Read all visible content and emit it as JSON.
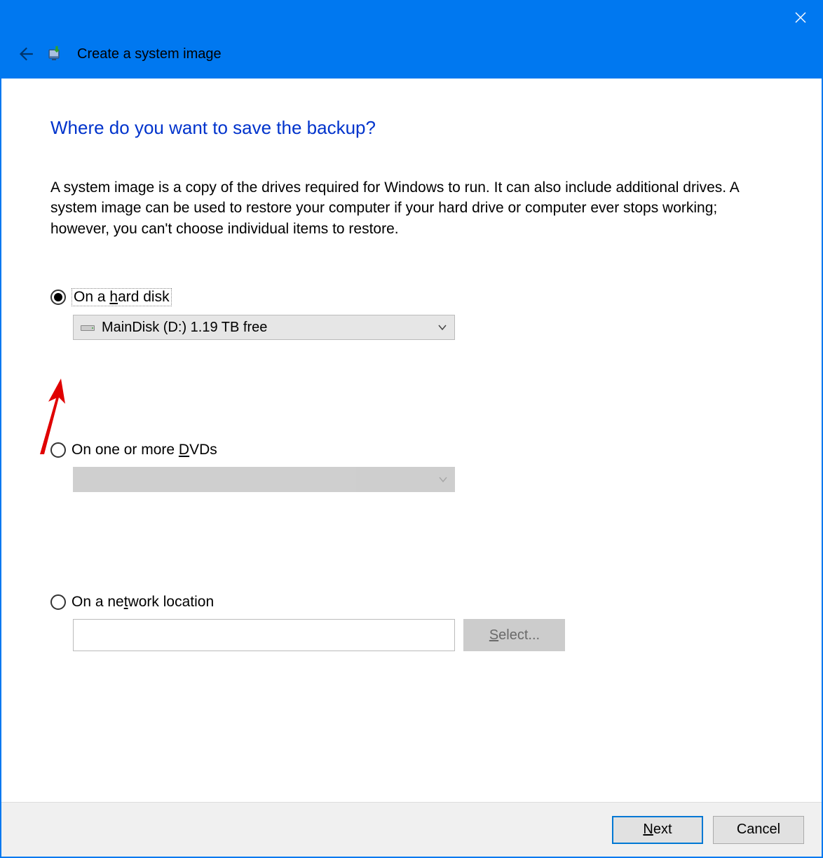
{
  "window": {
    "title": "Create a system image"
  },
  "main": {
    "heading": "Where do you want to save the backup?",
    "description": "A system image is a copy of the drives required for Windows to run. It can also include additional drives. A system image can be used to restore your computer if your hard drive or computer ever stops working; however, you can't choose individual items to restore."
  },
  "options": {
    "hard_disk": {
      "label_prefix": "On a ",
      "label_underlined": "h",
      "label_suffix": "ard disk",
      "selected_drive": "MainDisk (D:)  1.19 TB free",
      "selected": true
    },
    "dvd": {
      "label_prefix": "On one or more ",
      "label_underlined": "D",
      "label_suffix": "VDs",
      "selected": false
    },
    "network": {
      "label_prefix": "On a ne",
      "label_underlined": "t",
      "label_suffix": "work location",
      "value": "",
      "select_label_underlined": "S",
      "select_label_suffix": "elect...",
      "selected": false
    }
  },
  "footer": {
    "next_underlined": "N",
    "next_suffix": "ext",
    "cancel": "Cancel"
  }
}
